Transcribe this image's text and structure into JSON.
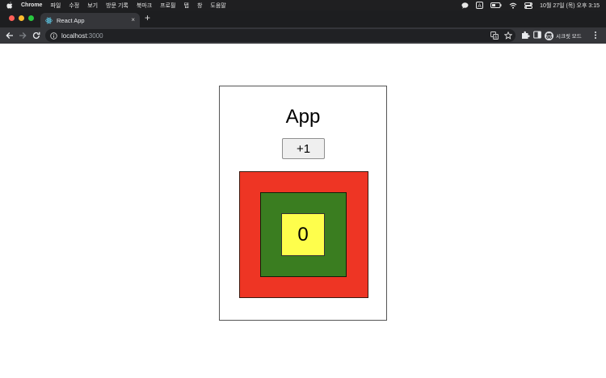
{
  "menubar": {
    "app_name": "Chrome",
    "items": [
      "파일",
      "수정",
      "보기",
      "방문 기록",
      "북마크",
      "프로필",
      "탭",
      "창",
      "도움말"
    ],
    "clock": "10월 27일 (목) 오후 3:15",
    "input_source": "A"
  },
  "browser": {
    "tab_title": "React App",
    "tab_close": "×",
    "new_tab": "+",
    "url_host": "localhost",
    "url_port": ":3000",
    "profile_label": "시크릿 모드"
  },
  "page": {
    "title": "App",
    "increment_label": "+1",
    "count": "0"
  },
  "colors": {
    "traffic_red": "#fe5f57",
    "traffic_yellow": "#febc2e",
    "traffic_green": "#28c840",
    "outer_box": "#ee3524",
    "middle_box": "#3a7d20",
    "inner_box": "#fefe4c",
    "react_logo": "#61dafb"
  },
  "icons": {
    "menubar_left": "apple-icon",
    "menubar_right": [
      "chat-bubble-icon",
      "input-source-icon",
      "battery-icon",
      "wifi-icon",
      "control-center-icon"
    ],
    "toolbar": [
      "back-arrow-icon",
      "forward-arrow-icon",
      "reload-icon",
      "info-icon",
      "translate-icon",
      "bookmark-star-icon",
      "extensions-puzzle-icon",
      "side-panel-icon",
      "incognito-icon",
      "more-menu-icon"
    ],
    "tab_favicon": "react-logo-icon"
  }
}
